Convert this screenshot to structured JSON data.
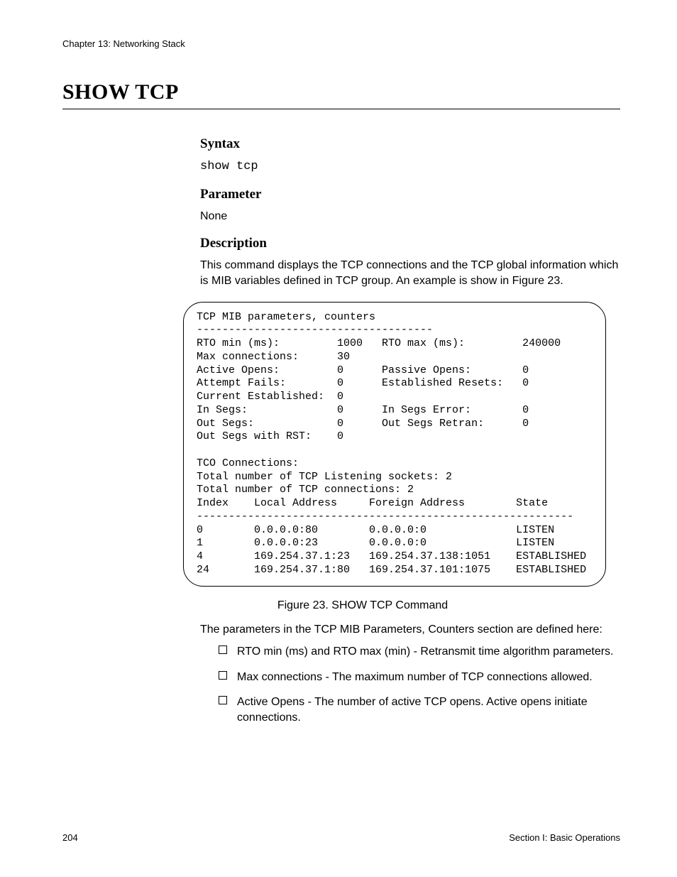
{
  "header": {
    "chapter": "Chapter 13: Networking Stack"
  },
  "title": "SHOW TCP",
  "sections": {
    "syntax_head": "Syntax",
    "syntax_cmd": "show tcp",
    "parameter_head": "Parameter",
    "parameter_body": "None",
    "description_head": "Description",
    "description_body": "This command displays the TCP connections and the TCP global information which is MIB variables defined in TCP group. An example is show in Figure 23."
  },
  "figure": {
    "caption": "Figure 23. SHOW TCP Command",
    "text": "TCP MIB parameters, counters\n-------------------------------------\nRTO min (ms):         1000   RTO max (ms):         240000\nMax connections:      30\nActive Opens:         0      Passive Opens:        0\nAttempt Fails:        0      Established Resets:   0\nCurrent Established:  0\nIn Segs:              0      In Segs Error:        0\nOut Segs:             0      Out Segs Retran:      0\nOut Segs with RST:    0\n\nTCO Connections:\nTotal number of TCP Listening sockets: 2\nTotal number of TCP connections: 2\nIndex    Local Address     Foreign Address        State\n-----------------------------------------------------------\n0        0.0.0.0:80        0.0.0.0:0              LISTEN\n1        0.0.0.0:23        0.0.0.0:0              LISTEN\n4        169.254.37.1:23   169.254.37.138:1051    ESTABLISHED\n24       169.254.37.1:80   169.254.37.101:1075    ESTABLISHED"
  },
  "post_figure_para": "The parameters in the TCP MIB Parameters, Counters section are defined here:",
  "bullets": [
    "RTO min (ms) and RTO max (min) - Retransmit time algorithm parameters.",
    "Max connections - The maximum number of TCP connections allowed.",
    "Active Opens - The number of active TCP opens. Active opens initiate connections."
  ],
  "footer": {
    "page": "204",
    "section": "Section I: Basic Operations"
  }
}
